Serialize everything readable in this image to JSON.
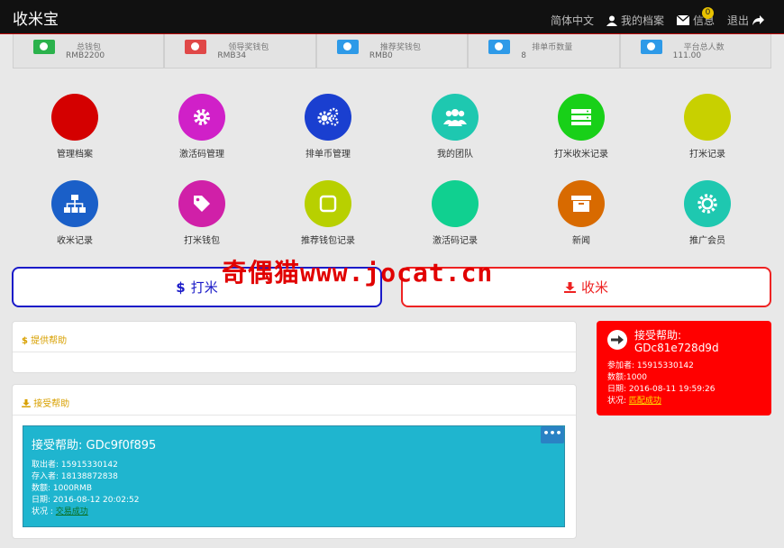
{
  "header": {
    "brand": "收米宝",
    "nav": {
      "language": "简体中文",
      "profile": "我的档案",
      "messages": "信息",
      "message_count": "0",
      "logout": "退出"
    }
  },
  "stats": [
    {
      "label": "总钱包",
      "value": "RMB2200",
      "color": "#2bb24c"
    },
    {
      "label": "领导奖钱包",
      "value": "RMB34",
      "color": "#e04848"
    },
    {
      "label": "推荐奖钱包",
      "value": "RMB0",
      "color": "#2e9ae8"
    },
    {
      "label": "排单币数量",
      "value": "8",
      "color": "#2e9ae8"
    },
    {
      "label": "平台总人数",
      "value": "111.00",
      "color": "#2e9ae8"
    }
  ],
  "tiles": [
    {
      "label": "管理档案",
      "color": "#d40000",
      "icon": "none"
    },
    {
      "label": "激活码管理",
      "color": "#d020c8",
      "icon": "gear-icon"
    },
    {
      "label": "排单币管理",
      "color": "#1a3fd0",
      "icon": "gears-icon"
    },
    {
      "label": "我的团队",
      "color": "#1ec8b0",
      "icon": "users-icon"
    },
    {
      "label": "打米收米记录",
      "color": "#18d018",
      "icon": "server-icon"
    },
    {
      "label": "打米记录",
      "color": "#c8d000",
      "icon": "none"
    },
    {
      "label": "收米记录",
      "color": "#1a5fc8",
      "icon": "sitemap-icon"
    },
    {
      "label": "打米钱包",
      "color": "#d020a8",
      "icon": "tag-icon"
    },
    {
      "label": "推荐钱包记录",
      "color": "#b8d000",
      "icon": "square-icon"
    },
    {
      "label": "激活码记录",
      "color": "#10d090",
      "icon": "none"
    },
    {
      "label": "新闻",
      "color": "#d86a00",
      "icon": "archive-icon"
    },
    {
      "label": "推广会员",
      "color": "#1ec8b0",
      "icon": "sun-icon"
    }
  ],
  "actions": {
    "give": "打米",
    "take": "收米",
    "watermark": "奇偶猫www.jocat.cn"
  },
  "provide_panel": {
    "title": "提供帮助"
  },
  "receive_panel": {
    "title": "接受帮助",
    "card": {
      "title": "接受帮助: GDc9f0f895",
      "menu": "•••",
      "lines": [
        "取出者: 15915330142",
        "存入者: 18138872838",
        "数额: 1000RMB",
        "日期: 2016-08-12 20:02:52"
      ],
      "status_label": "状况 : ",
      "status": "交易成功"
    }
  },
  "side_card": {
    "title_line1": "接受帮助:",
    "title_line2": "GDc81e728d9d",
    "lines": [
      "参加者: 15915330142",
      "数额:1000",
      "日期: 2016-08-11 19:59:26"
    ],
    "status_label": "状况: ",
    "status": "匹配成功"
  }
}
